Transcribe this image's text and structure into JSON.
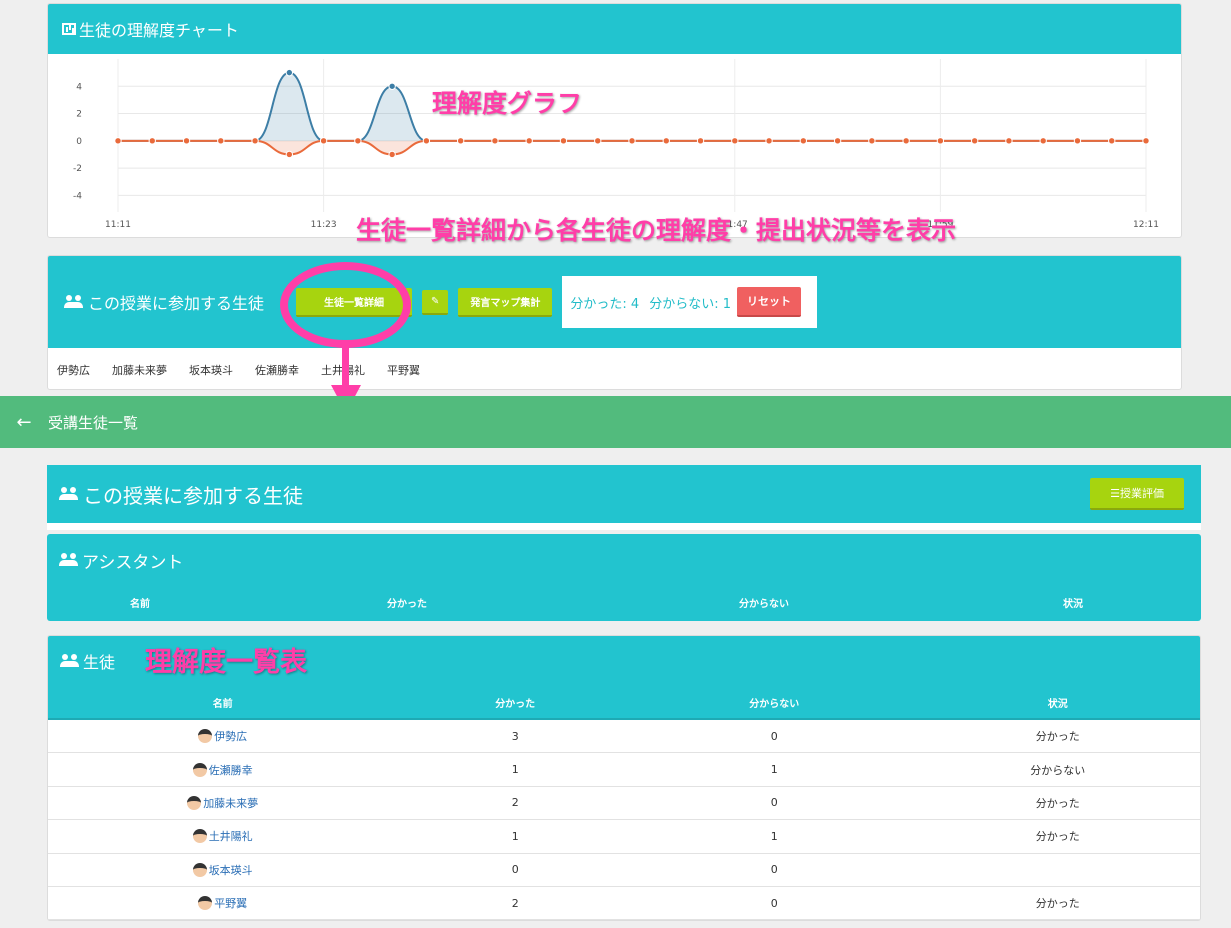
{
  "chart_panel": {
    "title": "生徒の理解度チャート"
  },
  "chart_data": {
    "type": "area",
    "x": [
      "11:11",
      "11:13",
      "11:15",
      "11:17",
      "11:19",
      "11:21",
      "11:23",
      "11:25",
      "11:27",
      "11:29",
      "11:31",
      "11:33",
      "11:35",
      "11:37",
      "11:39",
      "11:41",
      "11:43",
      "11:45",
      "11:47",
      "11:49",
      "11:51",
      "11:53",
      "11:55",
      "11:57",
      "11:59",
      "12:01",
      "12:03",
      "12:05",
      "12:07",
      "12:09",
      "12:11"
    ],
    "tick_labels": [
      "11:11",
      "11:23",
      "11:47",
      "11:59",
      "12:11"
    ],
    "yticks": [
      4,
      2,
      0,
      -2,
      -4
    ],
    "ylim": [
      -5,
      6
    ],
    "series": [
      {
        "color": "#3d7ea6",
        "values": [
          0,
          0,
          0,
          0,
          0,
          5,
          0,
          0,
          4,
          0,
          0,
          0,
          0,
          0,
          0,
          0,
          0,
          0,
          0,
          0,
          0,
          0,
          0,
          0,
          0,
          0,
          0,
          0,
          0,
          0,
          0
        ]
      },
      {
        "color": "#e96a3b",
        "values": [
          0,
          0,
          0,
          0,
          0,
          -1,
          0,
          0,
          -1,
          0,
          0,
          0,
          0,
          0,
          0,
          0,
          0,
          0,
          0,
          0,
          0,
          0,
          0,
          0,
          0,
          0,
          0,
          0,
          0,
          0,
          0
        ]
      }
    ]
  },
  "annotations": {
    "graph": "理解度グラフ",
    "detail": "生徒一覧詳細から各生徒の理解度・提出状況等を表示",
    "table": "理解度一覧表"
  },
  "participants": {
    "title": "この授業に参加する生徒",
    "detail_button": "生徒一覧詳細",
    "edit_icon": "edit-icon",
    "map_button": "発言マップ集計",
    "understood": "分かった: 4",
    "not_understood": "分からない: 1",
    "reset_button": "リセット",
    "names": [
      "伊勢広",
      "加藤未来夢",
      "坂本瑛斗",
      "佐瀬勝幸",
      "土井陽礼",
      "平野翼"
    ]
  },
  "nav": {
    "back_icon": "arrow-left-icon",
    "title": "受講生徒一覧"
  },
  "section_main": {
    "title": "この授業に参加する生徒",
    "eval_button": "授業評価"
  },
  "assistant": {
    "title": "アシスタント",
    "columns": [
      "名前",
      "分かった",
      "分からない",
      "状況"
    ]
  },
  "students": {
    "title": "生徒",
    "columns": [
      "名前",
      "分かった",
      "分からない",
      "状況"
    ],
    "rows": [
      {
        "name": "伊勢広",
        "yes": "3",
        "no": "0",
        "status": "分かった"
      },
      {
        "name": "佐瀬勝幸",
        "yes": "1",
        "no": "1",
        "status": "分からない"
      },
      {
        "name": "加藤未来夢",
        "yes": "2",
        "no": "0",
        "status": "分かった"
      },
      {
        "name": "土井陽礼",
        "yes": "1",
        "no": "1",
        "status": "分かった"
      },
      {
        "name": "坂本瑛斗",
        "yes": "0",
        "no": "0",
        "status": ""
      },
      {
        "name": "平野翼",
        "yes": "2",
        "no": "0",
        "status": "分かった"
      }
    ]
  }
}
